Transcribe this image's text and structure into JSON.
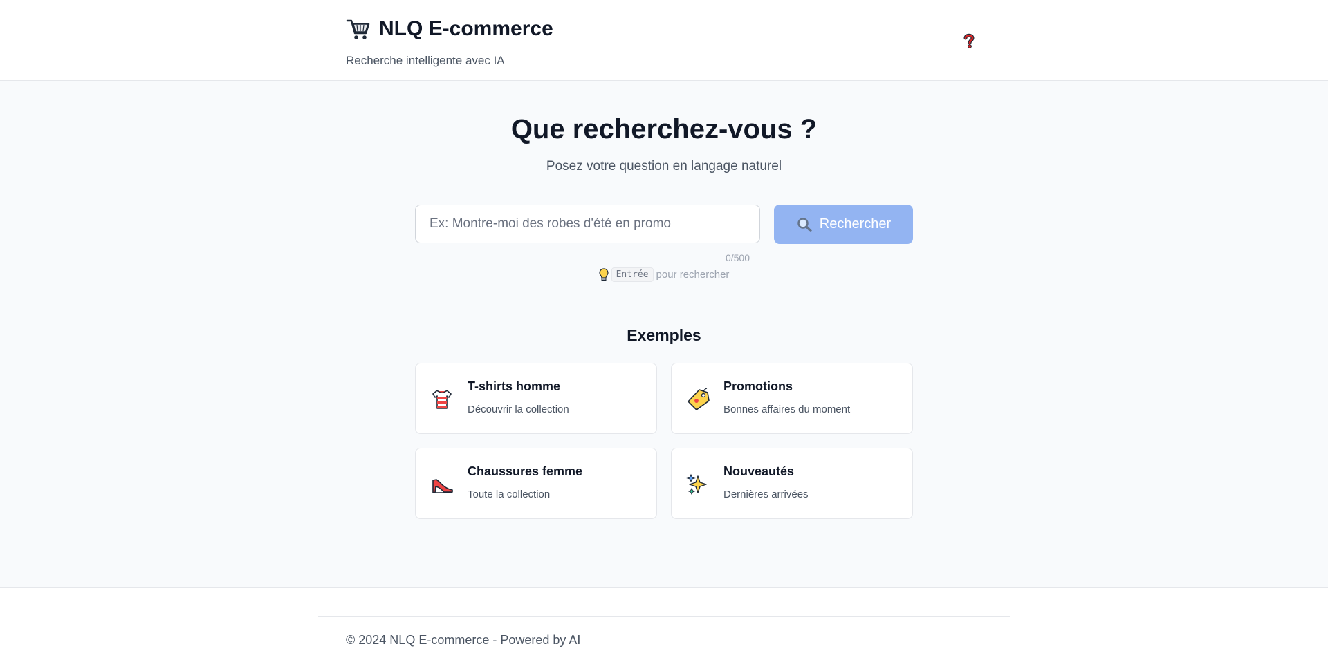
{
  "header": {
    "title": "NLQ E-commerce",
    "subtitle": "Recherche intelligente avec IA",
    "brand_icon": "shopping-cart-icon",
    "help_icon": "question-mark-icon"
  },
  "hero": {
    "title": "Que recherchez-vous ?",
    "subtitle": "Posez votre question en langage naturel"
  },
  "search": {
    "placeholder": "Ex: Montre-moi des robes d'été en promo",
    "value": "",
    "button_label": "Rechercher",
    "button_icon": "magnifier-icon",
    "counter": "0/500",
    "hint_key": "Entrée",
    "hint_text": "pour rechercher"
  },
  "examples": {
    "title": "Exemples",
    "items": [
      {
        "title": "T-shirts homme",
        "desc": "Découvrir la collection",
        "icon": "tshirt-icon"
      },
      {
        "title": "Promotions",
        "desc": "Bonnes affaires du moment",
        "icon": "price-tag-icon"
      },
      {
        "title": "Chaussures femme",
        "desc": "Toute la collection",
        "icon": "high-heel-icon"
      },
      {
        "title": "Nouveautés",
        "desc": "Dernières arrivées",
        "icon": "sparkles-icon"
      }
    ]
  },
  "footer": {
    "text": "© 2024 NLQ E-commerce - Powered by AI"
  },
  "colors": {
    "primary_button": "#93b4f2",
    "background": "#f8fafc",
    "text": "#111827"
  }
}
